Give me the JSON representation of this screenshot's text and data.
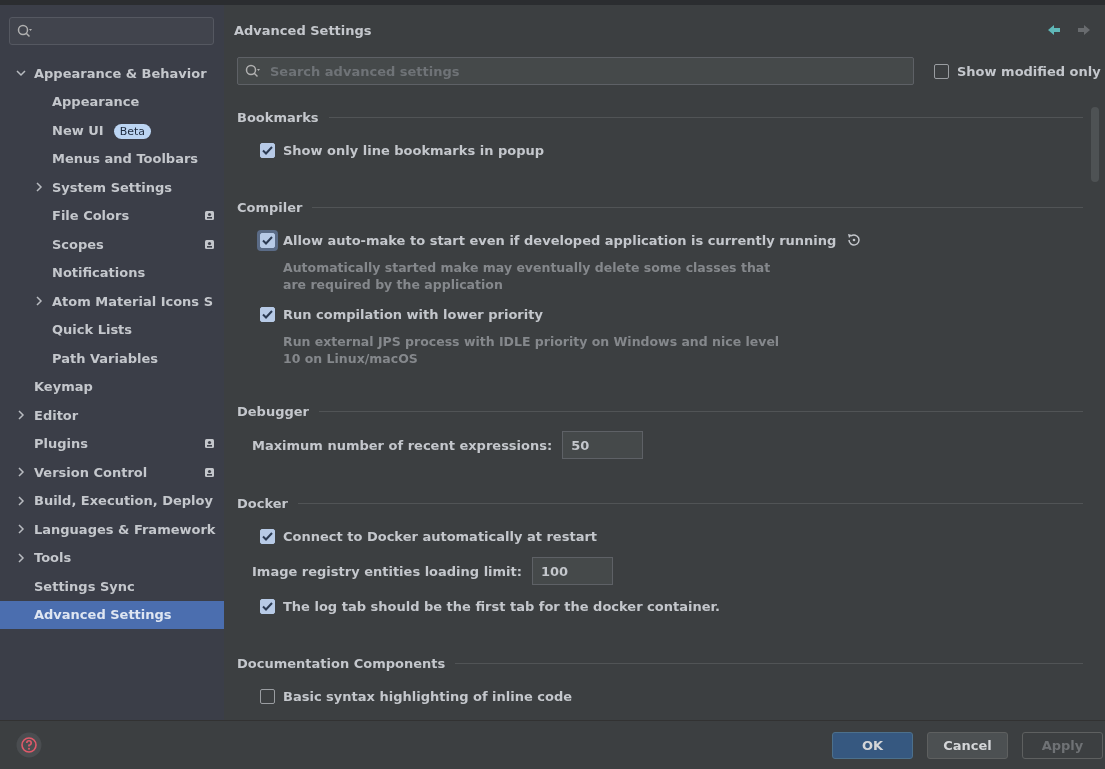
{
  "sidebar": {
    "items": [
      {
        "label": "Appearance & Behavior",
        "kind": "folder",
        "expanded": true,
        "selected": false,
        "children": [
          {
            "label": "Appearance",
            "kind": "leaf",
            "selected": false
          },
          {
            "label": "New UI",
            "badge": "Beta",
            "kind": "leaf",
            "selected": false
          },
          {
            "label": "Menus and Toolbars",
            "kind": "leaf",
            "selected": false
          },
          {
            "label": "System Settings",
            "kind": "folder",
            "expanded": false,
            "selected": false
          },
          {
            "label": "File Colors",
            "kind": "leaf",
            "selected": false,
            "project_icon": true
          },
          {
            "label": "Scopes",
            "kind": "leaf",
            "selected": false,
            "project_icon": true
          },
          {
            "label": "Notifications",
            "kind": "leaf",
            "selected": false
          },
          {
            "label": "Atom Material Icons S",
            "kind": "folder",
            "expanded": false,
            "selected": false
          },
          {
            "label": "Quick Lists",
            "kind": "leaf",
            "selected": false
          },
          {
            "label": "Path Variables",
            "kind": "leaf",
            "selected": false
          }
        ]
      },
      {
        "label": "Keymap",
        "kind": "leaf",
        "selected": false
      },
      {
        "label": "Editor",
        "kind": "folder",
        "expanded": false,
        "selected": false
      },
      {
        "label": "Plugins",
        "kind": "leaf",
        "selected": false,
        "project_icon": true
      },
      {
        "label": "Version Control",
        "kind": "folder",
        "expanded": false,
        "selected": false,
        "project_icon": true
      },
      {
        "label": "Build, Execution, Deploy",
        "kind": "folder",
        "expanded": false,
        "selected": false
      },
      {
        "label": "Languages & Framework",
        "kind": "folder",
        "expanded": false,
        "selected": false
      },
      {
        "label": "Tools",
        "kind": "folder",
        "expanded": false,
        "selected": false
      },
      {
        "label": "Settings Sync",
        "kind": "leaf",
        "selected": false
      },
      {
        "label": "Advanced Settings",
        "kind": "leaf",
        "selected": true
      }
    ]
  },
  "page": {
    "title": "Advanced Settings",
    "search": {
      "placeholder": "Search advanced settings"
    },
    "show_modified": {
      "label": "Show modified only",
      "checked": false
    }
  },
  "sections": [
    {
      "title": "Bookmarks",
      "items": [
        {
          "kind": "checkbox",
          "label": "Show only line bookmarks in popup",
          "checked": true,
          "focused": false
        }
      ]
    },
    {
      "title": "Compiler",
      "items": [
        {
          "kind": "checkbox",
          "label": "Allow auto-make to start even if developed application is currently running",
          "checked": true,
          "focused": true,
          "modified": true,
          "description": [
            "Automatically started make may eventually delete some classes that",
            "are required by the application"
          ]
        },
        {
          "kind": "checkbox",
          "label": "Run compilation with lower priority",
          "checked": true,
          "focused": false,
          "description": [
            "Run external JPS process with IDLE priority on Windows and nice level",
            "10 on Linux/macOS"
          ]
        }
      ]
    },
    {
      "title": "Debugger",
      "items": [
        {
          "kind": "number",
          "label": "Maximum number of recent expressions:",
          "value": "50"
        }
      ]
    },
    {
      "title": "Docker",
      "items": [
        {
          "kind": "checkbox",
          "label": "Connect to Docker automatically at restart",
          "checked": true,
          "focused": false
        },
        {
          "kind": "number",
          "label": "Image registry entities loading limit:",
          "value": "100"
        },
        {
          "kind": "checkbox",
          "label": "The log tab should be the first tab for the docker container.",
          "checked": true,
          "focused": false
        }
      ]
    },
    {
      "title": "Documentation Components",
      "items": [
        {
          "kind": "checkbox",
          "label": "Basic syntax highlighting of inline code",
          "checked": false,
          "focused": false
        }
      ]
    }
  ],
  "buttons": [
    {
      "label": "OK",
      "kind": "primary",
      "disabled": false
    },
    {
      "label": "Cancel",
      "kind": "normal",
      "disabled": false
    },
    {
      "label": "Apply",
      "kind": "normal",
      "disabled": true
    }
  ]
}
